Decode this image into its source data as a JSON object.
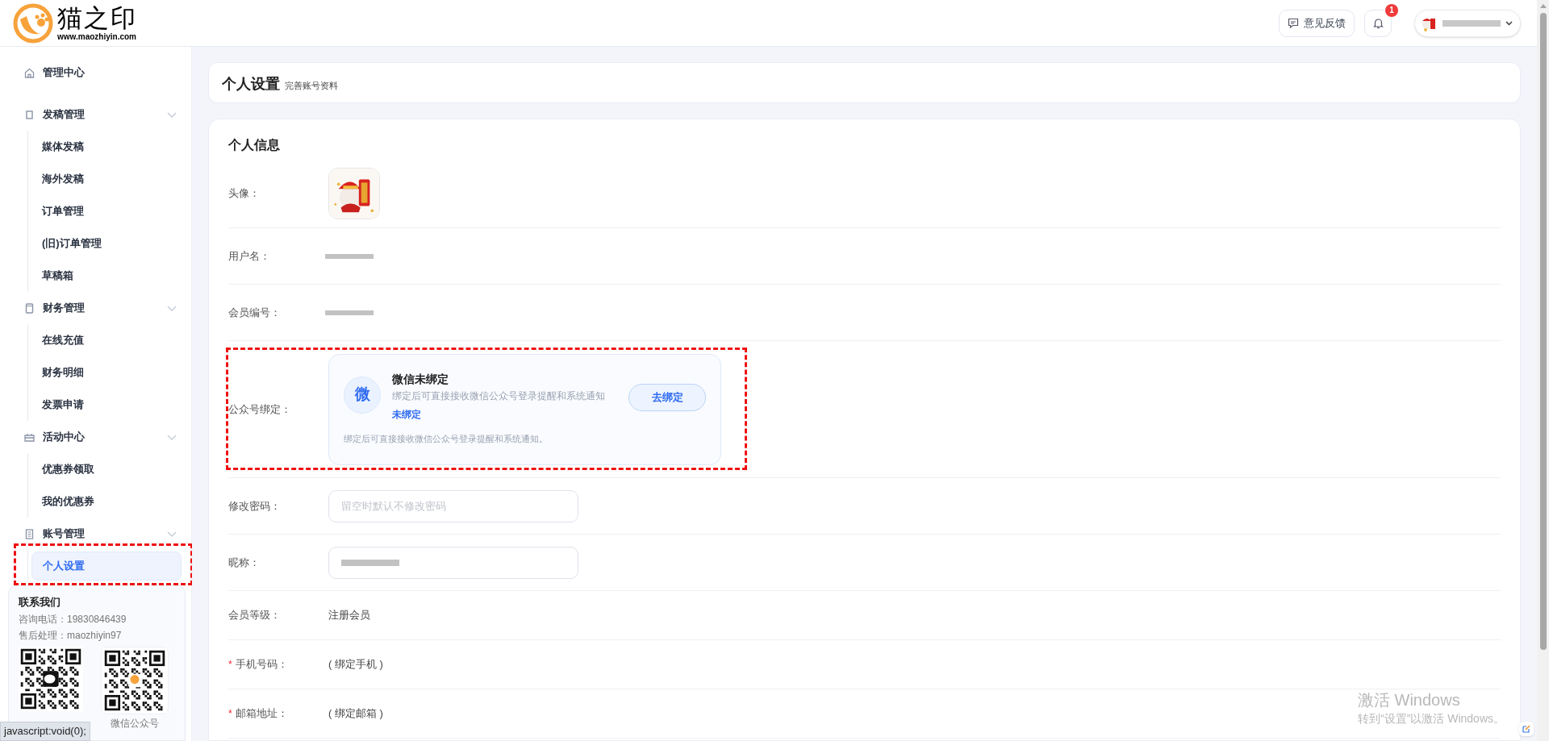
{
  "logo": {
    "name": "猫之印",
    "url": "www.maozhiyin.com"
  },
  "header": {
    "feedback": "意见反馈",
    "notification_badge": "1"
  },
  "sidebar": {
    "items": [
      {
        "kind": "link",
        "label": "管理中心"
      },
      {
        "kind": "group",
        "label": "发稿管理",
        "expanded": true,
        "children": [
          {
            "label": "媒体发稿",
            "selected": false
          },
          {
            "label": "海外发稿",
            "selected": false
          },
          {
            "label": "订单管理",
            "selected": false
          },
          {
            "label": "(旧)订单管理",
            "selected": false
          },
          {
            "label": "草稿箱",
            "selected": false
          }
        ]
      },
      {
        "kind": "group",
        "label": "财务管理",
        "expanded": true,
        "children": [
          {
            "label": "在线充值",
            "selected": false
          },
          {
            "label": "财务明细",
            "selected": false
          },
          {
            "label": "发票申请",
            "selected": false
          }
        ]
      },
      {
        "kind": "group",
        "label": "活动中心",
        "expanded": true,
        "children": [
          {
            "label": "优惠券领取",
            "selected": false
          },
          {
            "label": "我的优惠券",
            "selected": false
          }
        ]
      },
      {
        "kind": "group",
        "label": "账号管理",
        "expanded": true,
        "children": [
          {
            "label": "个人设置",
            "selected": true,
            "highlighted": true
          }
        ]
      }
    ]
  },
  "contact": {
    "title": "联系我们",
    "lines": [
      "咨询电话：19830846439",
      "售后处理：maozhiyin97"
    ],
    "qr_codes": [
      {
        "kind": "wechat"
      },
      {
        "kind": "logo",
        "caption": "微信公众号"
      }
    ]
  },
  "page_header": {
    "title": "个人设置",
    "subtitle": "完善账号资料"
  },
  "section": {
    "title": "个人信息",
    "fields": [
      {
        "kind": "avatar",
        "label": "头像："
      },
      {
        "kind": "redacted",
        "label": "用户名："
      },
      {
        "kind": "redacted",
        "label": "会员编号："
      },
      {
        "kind": "binding",
        "label": "公众号绑定：",
        "highlighted": true,
        "binding": {
          "badge": "微",
          "title": "微信未绑定",
          "description": "绑定后可直接接收微信公众号登录提醒和系统通知",
          "status": "未绑定",
          "button": "去绑定",
          "note": "绑定后可直接接收微信公众号登录提醒和系统通知。"
        }
      },
      {
        "kind": "input",
        "label": "修改密码：",
        "placeholder": "留空时默认不修改密码"
      },
      {
        "kind": "input",
        "label": "昵称：",
        "redacted": true
      },
      {
        "kind": "text",
        "label": "会员等级：",
        "value": "注册会员"
      },
      {
        "kind": "text",
        "label": "手机号码：",
        "required_mark": "*",
        "value": "( 绑定手机 )"
      },
      {
        "kind": "text",
        "label": "邮箱地址：",
        "required_mark": "*",
        "value": "( 绑定邮箱 )"
      }
    ]
  },
  "status_tooltip": "javascript:void(0);",
  "os_overlay": {
    "title": "激活 Windows",
    "subtitle": "转到“设置”以激活 Windows。"
  }
}
